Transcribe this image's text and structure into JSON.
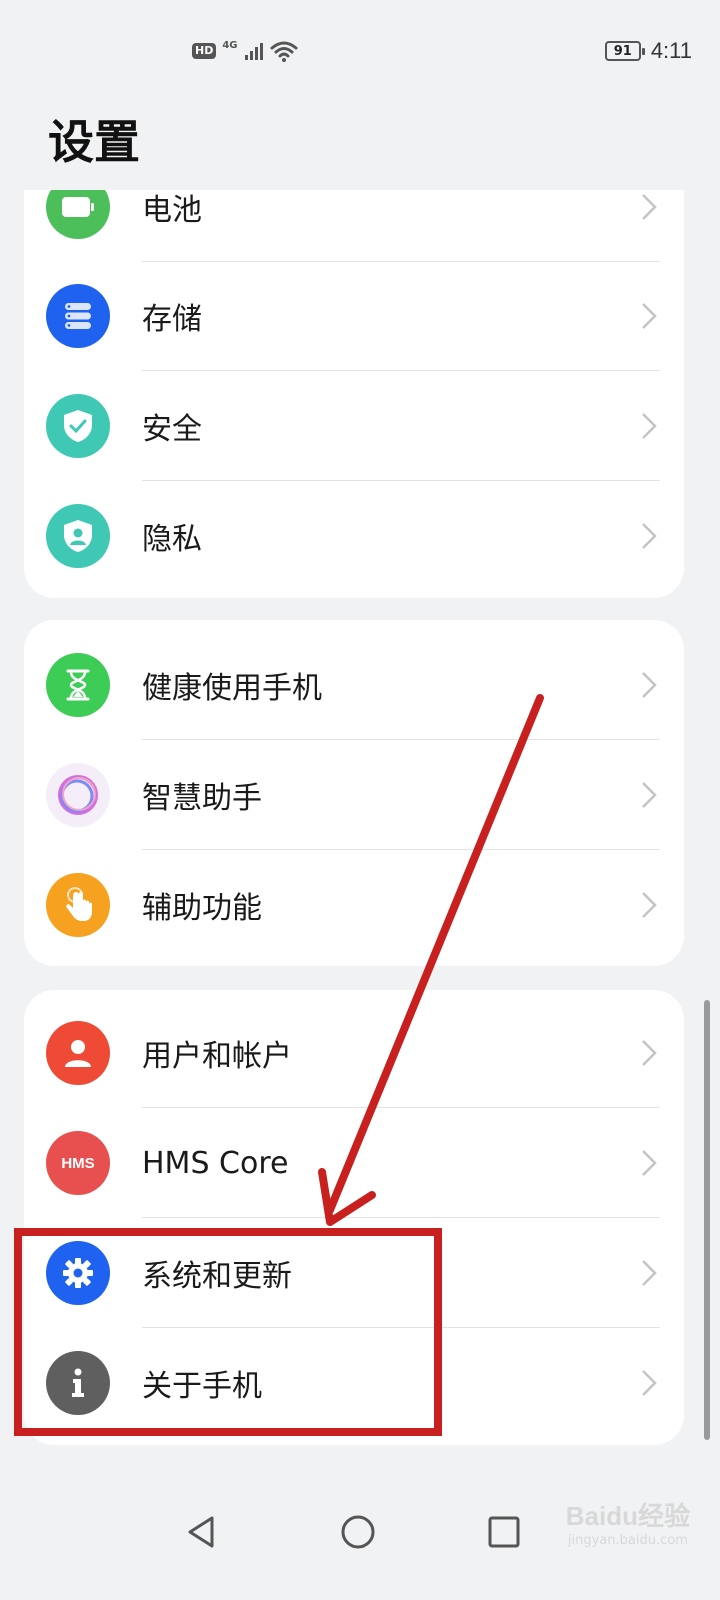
{
  "status_bar": {
    "hd": "HD",
    "network": "4G",
    "battery": "91",
    "time": "4:11"
  },
  "page": {
    "title": "设置"
  },
  "groups": [
    {
      "items": [
        {
          "label": "电池",
          "icon": "battery-icon",
          "color": "#4cbf5a"
        },
        {
          "label": "存储",
          "icon": "storage-icon",
          "color": "#1f62f0"
        },
        {
          "label": "安全",
          "icon": "shield-check-icon",
          "color": "#3fc9b4"
        },
        {
          "label": "隐私",
          "icon": "privacy-shield-icon",
          "color": "#3fc9b4"
        }
      ]
    },
    {
      "items": [
        {
          "label": "健康使用手机",
          "icon": "hourglass-icon",
          "color": "#3dcc56"
        },
        {
          "label": "智慧助手",
          "icon": "assistant-orb-icon",
          "color": "#f3eef8"
        },
        {
          "label": "辅助功能",
          "icon": "hand-touch-icon",
          "color": "#f6a11f"
        }
      ]
    },
    {
      "items": [
        {
          "label": "用户和帐户",
          "icon": "user-icon",
          "color": "#ee4a35"
        },
        {
          "label": "HMS Core",
          "icon": "hms-core-icon",
          "color": "#e8504f"
        },
        {
          "label": "系统和更新",
          "icon": "gear-icon",
          "color": "#1f62f0"
        },
        {
          "label": "关于手机",
          "icon": "info-icon",
          "color": "#5f5f5f"
        }
      ]
    }
  ],
  "hms_badge": "HMS",
  "annotation_color": "#c8201f",
  "watermark": {
    "main": "Baidu经验",
    "sub": "jingyan.baidu.com"
  }
}
